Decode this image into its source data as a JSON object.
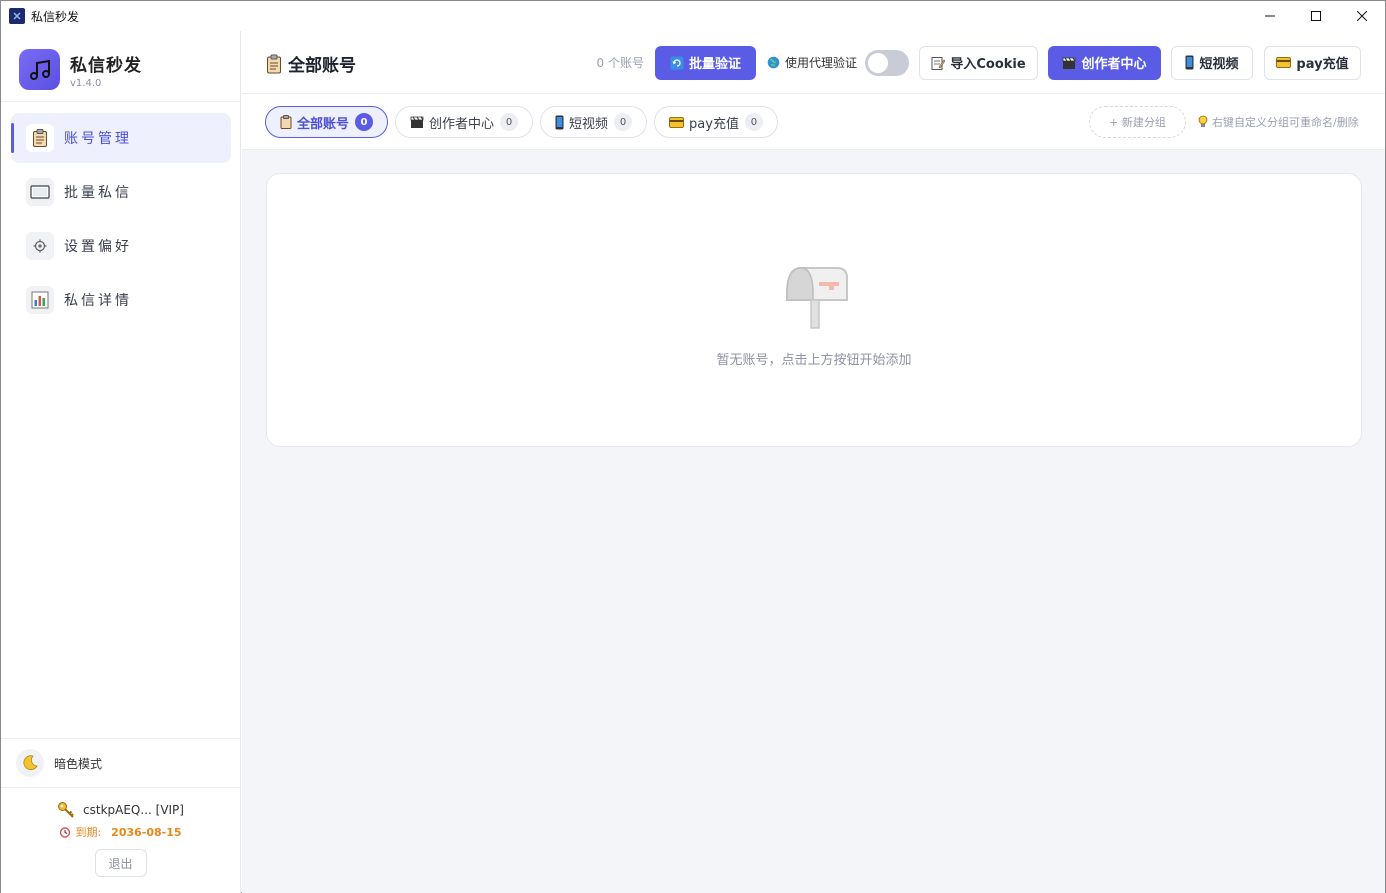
{
  "window": {
    "title": "私信秒发",
    "controls": {
      "minimize": "minimize",
      "maximize": "maximize",
      "close": "close"
    }
  },
  "brand": {
    "name": "私信秒发",
    "version": "v1.4.0",
    "logo_icon": "music-note-icon"
  },
  "sidebar": {
    "items": [
      {
        "label": "账号管理",
        "icon": "clipboard-icon",
        "active": true
      },
      {
        "label": "批量私信",
        "icon": "message-card-icon",
        "active": false
      },
      {
        "label": "设置偏好",
        "icon": "gear-icon",
        "active": false
      },
      {
        "label": "私信详情",
        "icon": "bar-chart-icon",
        "active": false
      }
    ],
    "dark_mode": {
      "label": "暗色模式",
      "icon": "moon-icon"
    },
    "user": {
      "account": "cstkpAEQ... [VIP]",
      "expire_label": "到期:",
      "expire_date": "2036-08-15",
      "logout_label": "退出"
    }
  },
  "header": {
    "title": "全部账号",
    "account_count": "0 个账号",
    "batch_verify_label": "批量验证",
    "proxy_label": "使用代理验证",
    "proxy_enabled": false,
    "import_cookie_label": "导入Cookie",
    "creator_center_label": "创作者中心",
    "short_video_label": "短视频",
    "pay_label": "pay充值"
  },
  "tabs": [
    {
      "label": "全部账号",
      "count": "0",
      "icon": "clipboard-icon",
      "active": true
    },
    {
      "label": "创作者中心",
      "count": "0",
      "icon": "clapper-icon",
      "active": false
    },
    {
      "label": "短视频",
      "count": "0",
      "icon": "phone-icon",
      "active": false
    },
    {
      "label": "pay充值",
      "count": "0",
      "icon": "card-icon",
      "active": false
    }
  ],
  "group": {
    "new_label": "+ 新建分组",
    "hint": "右键自定义分组可重命名/删除"
  },
  "empty": {
    "text": "暂无账号，点击上方按钮开始添加",
    "icon": "mailbox-icon"
  },
  "colors": {
    "accent": "#5b5ce6",
    "accent_light": "#eef0fd",
    "warning": "#e8861a",
    "background": "#f4f5f9"
  }
}
